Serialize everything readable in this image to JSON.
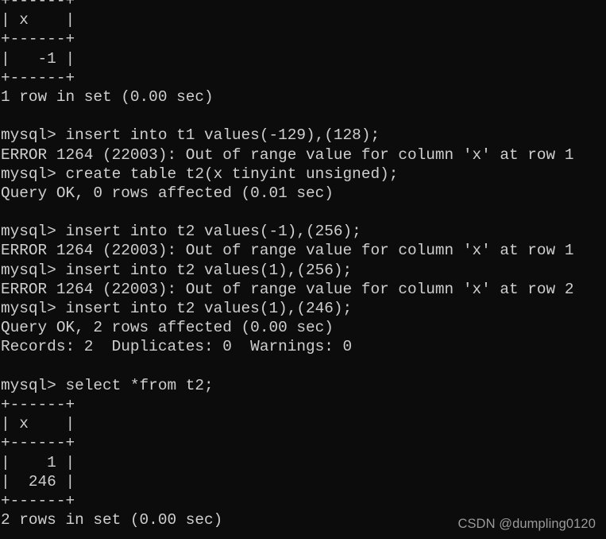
{
  "terminal": {
    "background_color": "#0c0c0c",
    "foreground_color": "#cfcfcf",
    "prompt": "mysql>",
    "lines": [
      "+------+",
      "| x    |",
      "+------+",
      "|   -1 |",
      "+------+",
      "1 row in set (0.00 sec)",
      "",
      "mysql> insert into t1 values(-129),(128);",
      "ERROR 1264 (22003): Out of range value for column 'x' at row 1",
      "mysql> create table t2(x tinyint unsigned);",
      "Query OK, 0 rows affected (0.01 sec)",
      "",
      "mysql> insert into t2 values(-1),(256);",
      "ERROR 1264 (22003): Out of range value for column 'x' at row 1",
      "mysql> insert into t2 values(1),(256);",
      "ERROR 1264 (22003): Out of range value for column 'x' at row 2",
      "mysql> insert into t2 values(1),(246);",
      "Query OK, 2 rows affected (0.00 sec)",
      "Records: 2  Duplicates: 0  Warnings: 0",
      "",
      "mysql> select *from t2;",
      "+------+",
      "| x    |",
      "+------+",
      "|    1 |",
      "|  246 |",
      "+------+",
      "2 rows in set (0.00 sec)"
    ]
  },
  "watermark": {
    "text": "CSDN @dumpling0120",
    "color": "#9a9a9a"
  }
}
